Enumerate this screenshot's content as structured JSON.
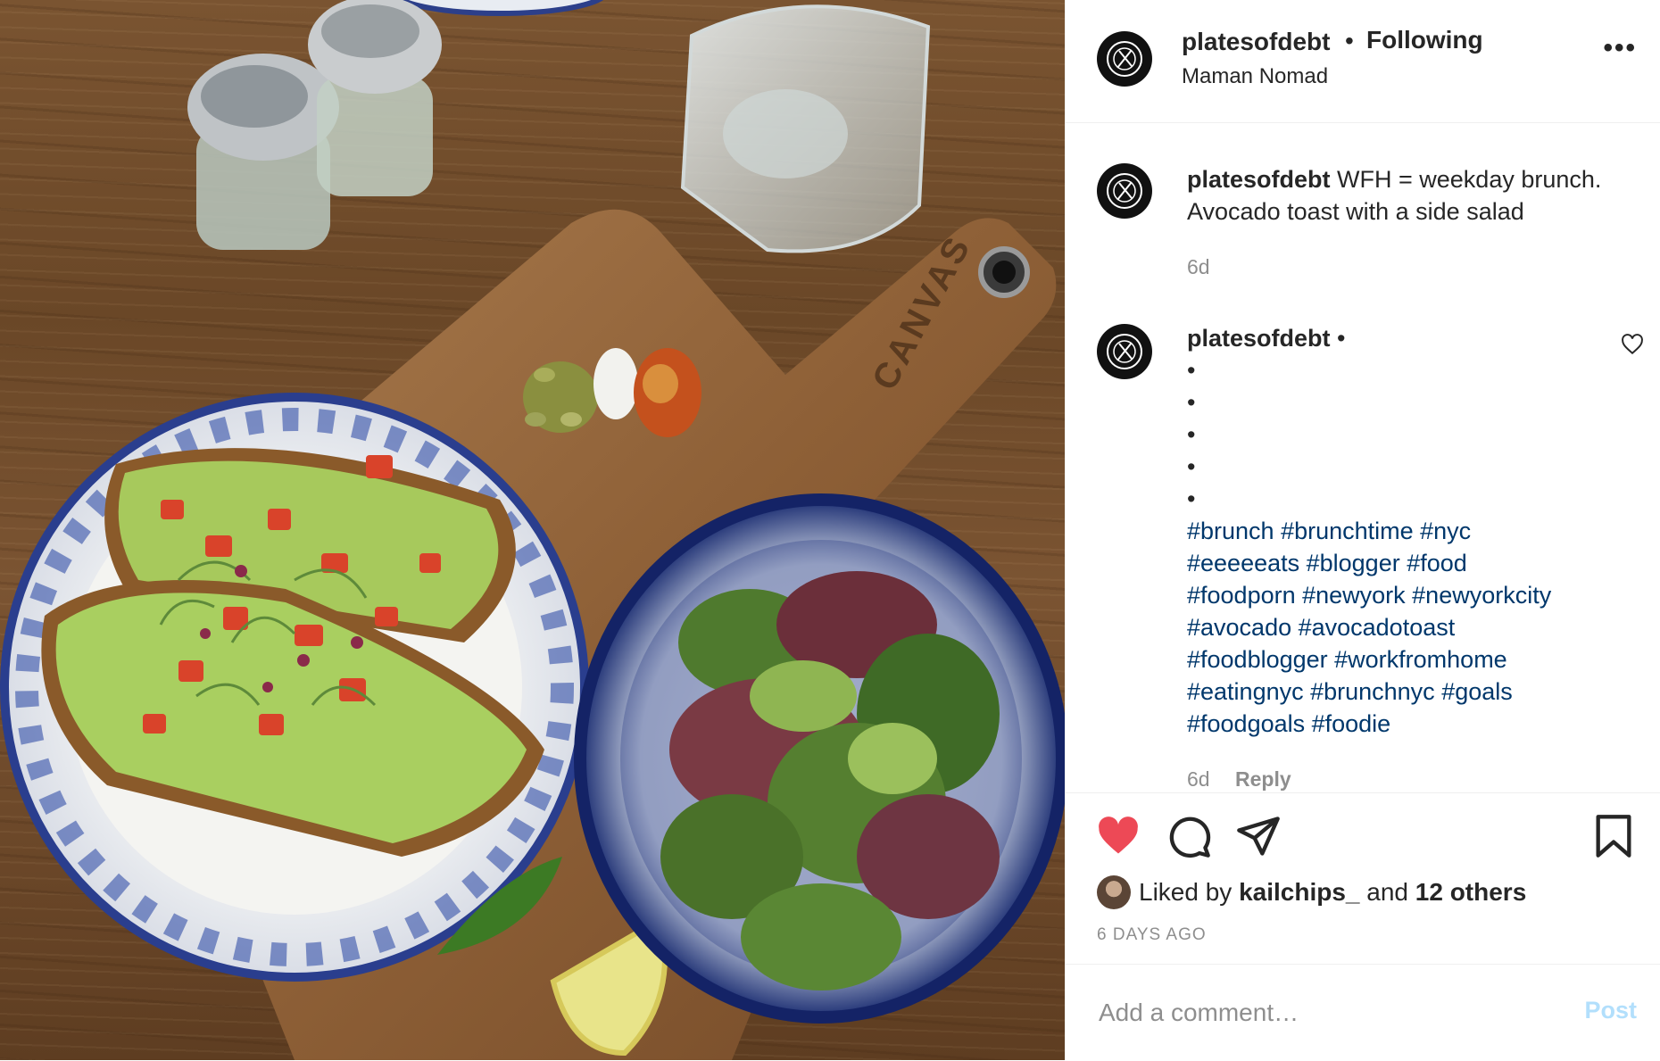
{
  "post": {
    "username": "platesofdebt",
    "follow_status": "Following",
    "location": "Maman Nomad",
    "more_icon": "more-options-icon"
  },
  "caption": {
    "username": "platesofdebt",
    "text": "WFH = weekday brunch. Avocado toast with a side salad",
    "time": "6d"
  },
  "comment": {
    "username": "platesofdebt",
    "dot": "•",
    "bullets": [
      "•",
      "•",
      "•",
      "•",
      "•"
    ],
    "hashtags": [
      "#brunch #brunchtime #nyc",
      "#eeeeeats #blogger #food",
      "#foodporn #newyork #newyorkcity",
      "#avocado #avocadotoast",
      "#foodblogger #workfromhome",
      "#eatingnyc #brunchnyc #goals",
      "#foodgoals #foodie"
    ],
    "time": "6d",
    "reply_label": "Reply"
  },
  "actions": {
    "liked_prefix": "Liked by",
    "liked_user": "kailchips_",
    "liked_and": "and",
    "liked_others": "12 others",
    "time_ago": "6 DAYS AGO",
    "like_color": "#ed4956"
  },
  "add_comment": {
    "placeholder": "Add a comment…",
    "post_label": "Post"
  },
  "photo": {
    "board_text": "CANVAS"
  }
}
